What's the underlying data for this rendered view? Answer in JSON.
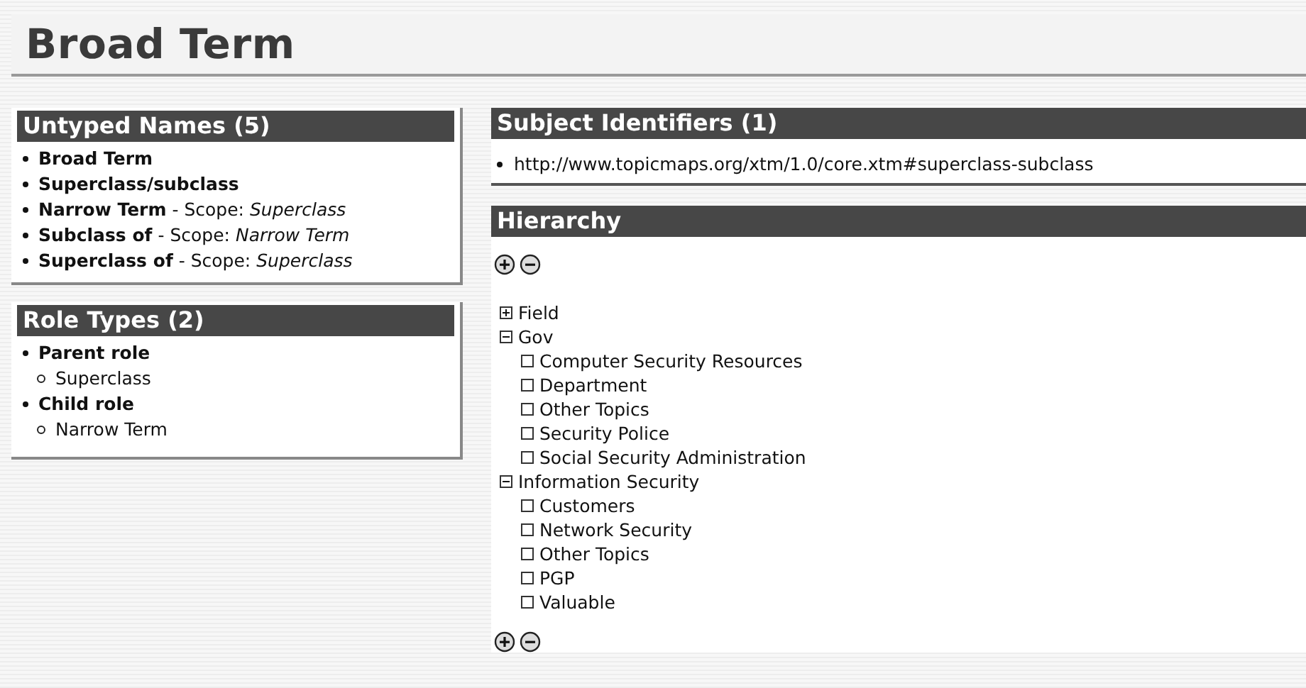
{
  "page_title": "Broad Term",
  "untyped_names": {
    "title": "Untyped Names (5)",
    "items": [
      {
        "text": "**Broad Term**"
      },
      {
        "text": "**Superclass/subclass**"
      },
      {
        "text": "**Narrow Term** - Scope: *Superclass*"
      },
      {
        "text": "**Subclass of** - Scope: *Narrow Term*"
      },
      {
        "text": "**Superclass of** - Scope: *Superclass*"
      }
    ]
  },
  "role_types": {
    "title": "Role Types (2)",
    "items": [
      {
        "label": "Parent role",
        "children": [
          {
            "label": "Superclass"
          }
        ]
      },
      {
        "label": "Child role",
        "children": [
          {
            "label": "Narrow Term"
          }
        ]
      }
    ]
  },
  "subject_identifiers": {
    "title": "Subject Identifiers (1)",
    "items": [
      "http://www.topicmaps.org/xtm/1.0/core.xtm#superclass-subclass"
    ]
  },
  "hierarchy": {
    "title": "Hierarchy",
    "tree": [
      {
        "label": "Field",
        "kind": "node",
        "expanded": false
      },
      {
        "label": "Gov",
        "kind": "node",
        "expanded": true,
        "children": [
          {
            "label": "Computer Security Resources",
            "kind": "leaf"
          },
          {
            "label": "Department",
            "kind": "leaf"
          },
          {
            "label": "Other Topics",
            "kind": "leaf"
          },
          {
            "label": "Security Police",
            "kind": "leaf"
          },
          {
            "label": "Social Security Administration",
            "kind": "leaf"
          }
        ]
      },
      {
        "label": "Information Security",
        "kind": "node",
        "expanded": true,
        "children": [
          {
            "label": "Customers",
            "kind": "leaf"
          },
          {
            "label": "Network Security",
            "kind": "leaf"
          },
          {
            "label": "Other Topics",
            "kind": "leaf"
          },
          {
            "label": "PGP",
            "kind": "leaf"
          },
          {
            "label": "Valuable",
            "kind": "leaf"
          }
        ]
      }
    ]
  }
}
